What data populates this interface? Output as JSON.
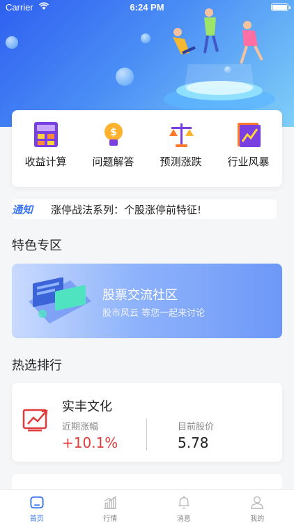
{
  "status_bar": {
    "carrier": "Carrier",
    "time": "6:24 PM"
  },
  "tools": [
    {
      "label": "收益计算",
      "icon": "calculator-icon"
    },
    {
      "label": "问题解答",
      "icon": "bulb-dollar-icon"
    },
    {
      "label": "预测涨跌",
      "icon": "scale-icon"
    },
    {
      "label": "行业风暴",
      "icon": "trend-chart-icon"
    }
  ],
  "notice": {
    "tag": "通知",
    "text": "涨停战法系列：个股涨停前特征!"
  },
  "sections": {
    "featured": "特色专区",
    "hot": "热选排行"
  },
  "community": {
    "title": "股票交流社区",
    "subtitle": "股市风云 等您一起来讨论"
  },
  "stock": {
    "name": "实丰文化",
    "change_label": "近期涨幅",
    "change_value": "+10.1%",
    "price_label": "目前股价",
    "price_value": "5.78"
  },
  "tabs": [
    {
      "label": "首页",
      "icon": "home-icon",
      "active": true
    },
    {
      "label": "行情",
      "icon": "market-chart-icon",
      "active": false
    },
    {
      "label": "消息",
      "icon": "bell-icon",
      "active": false
    },
    {
      "label": "我的",
      "icon": "user-icon",
      "active": false
    }
  ],
  "colors": {
    "accent": "#3d78f0",
    "up": "#e23b3b",
    "hero_start": "#2e5ff0",
    "hero_end": "#7fcff8"
  }
}
